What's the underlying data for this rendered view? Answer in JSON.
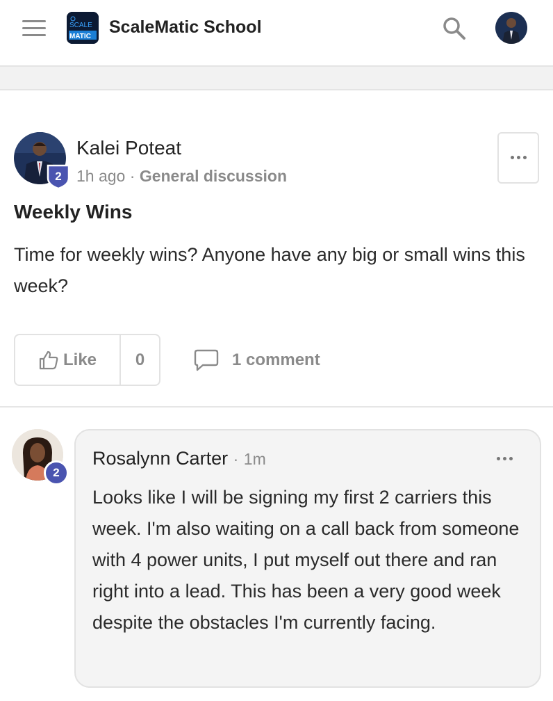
{
  "header": {
    "app_title": "ScaleMatic School",
    "logo_text_top": "SCALE",
    "logo_text_bottom": "MATIC"
  },
  "post": {
    "author": "Kalei Poteat",
    "level": "2",
    "time": "1h ago",
    "separator": "·",
    "category": "General discussion",
    "title": "Weekly Wins",
    "body": "Time for weekly wins? Anyone have any big or small wins this week?",
    "like_label": "Like",
    "like_count": "0",
    "comment_label": "1 comment"
  },
  "comment": {
    "author": "Rosalynn Carter",
    "separator": "·",
    "time": "1m",
    "level": "2",
    "text": "Looks like I will be signing my first 2 carriers this week. I'm also waiting on a call back from someone with 4 power units, I put myself out there and ran right into a lead. This has been a very good week despite the obstacles I'm currently facing."
  },
  "icons": {
    "menu": "hamburger-icon",
    "search": "search-icon",
    "more": "ellipsis-icon",
    "like": "thumbs-up-icon",
    "comment": "speech-bubble-icon"
  },
  "colors": {
    "badge": "#4a54b0",
    "muted_text": "#8a8a8a",
    "logo_bg": "#0c1a33",
    "logo_accent": "#3aa3ff"
  }
}
